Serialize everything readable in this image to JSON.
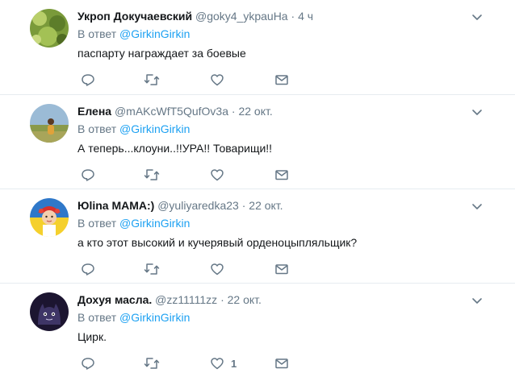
{
  "tweets": [
    {
      "name": "Укроп Докучаевский",
      "handle": "@goky4_ykpauHa",
      "separator": "·",
      "time": "4 ч",
      "replying_prefix": "В ответ",
      "replying_to": "@GirkinGirkin",
      "text": "паспарту награждает за боевые",
      "like_count": ""
    },
    {
      "name": "Елена",
      "handle": "@mAKcWfT5QufOv3a",
      "separator": "·",
      "time": "22 окт.",
      "replying_prefix": "В ответ",
      "replying_to": "@GirkinGirkin",
      "text": "А теперь...клоуни..!!УРА!! Товарищи!!",
      "like_count": ""
    },
    {
      "name": "Юlina МАМА:)",
      "handle": "@yuliyaredka23",
      "separator": "·",
      "time": "22 окт.",
      "replying_prefix": "В ответ",
      "replying_to": "@GirkinGirkin",
      "text": "а кто этот высокий и кучерявый орденоцыпляльщик?",
      "like_count": ""
    },
    {
      "name": "Дохуя масла.",
      "handle": "@zz11111zz",
      "separator": "·",
      "time": "22 окт.",
      "replying_prefix": "В ответ",
      "replying_to": "@GirkinGirkin",
      "text": "Цирк.",
      "like_count": "1"
    }
  ],
  "icons": {
    "reply": "reply-icon",
    "retweet": "retweet-icon",
    "like": "heart-icon",
    "message": "envelope-icon",
    "caret": "chevron-down-icon"
  },
  "colors": {
    "link": "#1da1f2",
    "secondary": "#657786",
    "border": "#e6ecf0"
  }
}
